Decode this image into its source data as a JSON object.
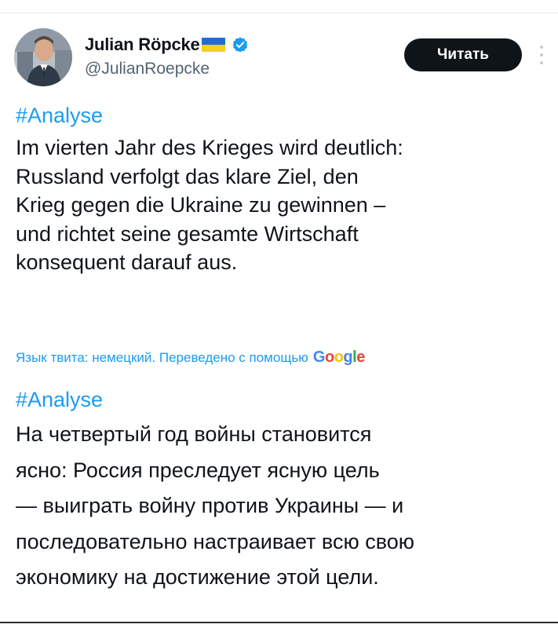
{
  "author": {
    "display_name": "Julian Röpcke",
    "handle": "@JulianRoepcke",
    "flag_icon": "ukraine-flag-icon",
    "verified_icon": "verified-badge-icon",
    "verified_color": "#1d9bf0"
  },
  "actions": {
    "read_label": "Читать",
    "more_icon": "more-vertical-icon"
  },
  "tweet": {
    "hashtag": "#Analyse",
    "lines": [
      "Im vierten Jahr des Krieges wird deutlich:",
      "Russland verfolgt das klare Ziel, den",
      "Krieg gegen die Ukraine zu gewinnen –",
      "und richtet seine gesamte Wirtschaft",
      "konsequent darauf aus."
    ]
  },
  "translation": {
    "note": "Язык твита: немецкий. Переведено с помощью",
    "provider": "Google",
    "hashtag": "#Analyse",
    "lines": [
      "На четвертый год войны становится",
      "ясно: Россия преследует ясную цель",
      "— выиграть войну против Украины — и",
      "последовательно настраивает всю свою",
      "экономику на достижение этой цели."
    ]
  },
  "colors": {
    "link": "#1d9bf0",
    "text": "#0f1419",
    "secondary": "#536471",
    "button_bg": "#0f1419"
  }
}
